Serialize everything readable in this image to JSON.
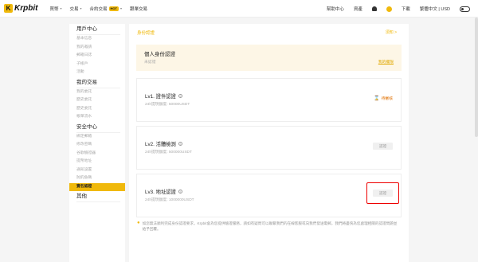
{
  "header": {
    "logo_mark": "K",
    "logo_text": "Krpbit",
    "nav": [
      {
        "label": "買幣",
        "caret": "▾"
      },
      {
        "label": "交易",
        "caret": "▾"
      },
      {
        "label": "合約交易",
        "caret": "▾",
        "badge": "HOT"
      },
      {
        "label": "跟單交易"
      }
    ],
    "right": {
      "help": "幫助中心",
      "assets": "資產",
      "download": "下載",
      "lang": "繁體中文 | USD"
    }
  },
  "sidebar": {
    "sections": [
      {
        "title": "用戶中心",
        "items": [
          "基本信息",
          "我的邀請",
          "郵箱日誌",
          "子帳戶",
          "活動"
        ]
      },
      {
        "title": "我的交易",
        "items": [
          "我的委託",
          "歷史委託",
          "歷史委託",
          "帳單流水"
        ]
      },
      {
        "title": "安全中心",
        "items": [
          "綁定郵箱",
          "修改密碼",
          "谷歌驗證器",
          "提幣地址",
          "通知設置",
          "防釣魚碼",
          "實名認證"
        ]
      },
      {
        "title": "其他",
        "items": []
      }
    ],
    "active_item": "實名認證"
  },
  "main": {
    "heading": "身份認證",
    "top_link": "須知 >",
    "personal": {
      "title": "個人身份認證",
      "status": "未認證",
      "action": "我的權限"
    },
    "levels": [
      {
        "title": "Lv1. 證件認證",
        "limit": "24h提現額度: 50000USDT",
        "status": "待審核"
      },
      {
        "title": "Lv2. 活體檢測",
        "limit": "24h提現額度: 500000USDT",
        "button": "認證"
      },
      {
        "title": "Lv3. 地址認證",
        "limit": "24h提現額度: 1000000USDT",
        "button": "認證"
      }
    ],
    "notice": "如您無法順利完成身份認證要求，Krpbit會為您提供驗證服務，請如有疑問可以聯繫我們的在線客服或向我們發送電郵，我們將盡快為您處理相關的認證問題並給予回覆。"
  },
  "colors": {
    "accent": "#f0b90b",
    "highlight": "#ee0000",
    "pending": "#e07000"
  }
}
